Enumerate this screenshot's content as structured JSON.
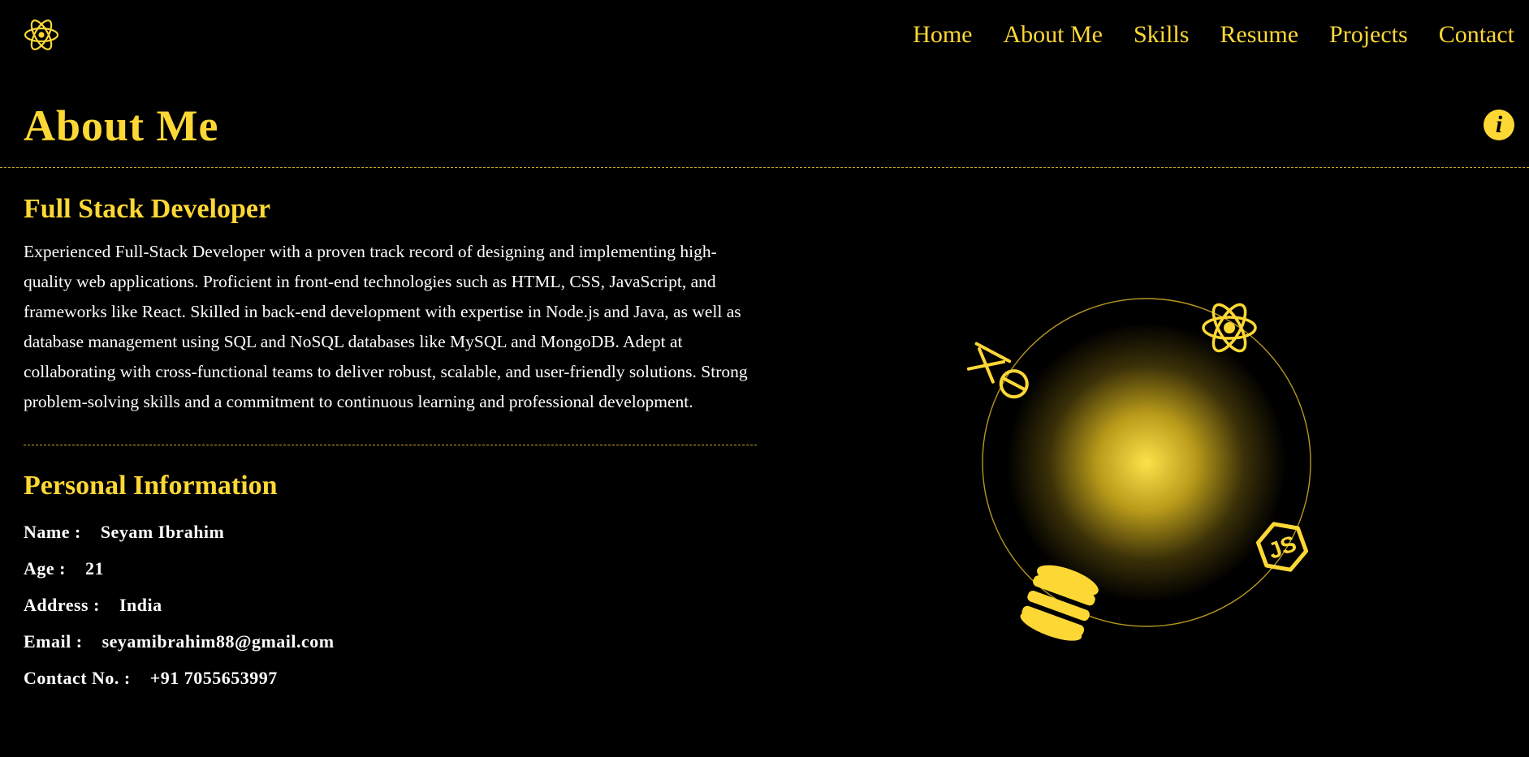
{
  "header": {
    "logo_icon": "react-atom-icon",
    "nav": [
      {
        "label": "Home"
      },
      {
        "label": "About Me"
      },
      {
        "label": "Skills"
      },
      {
        "label": "Resume"
      },
      {
        "label": "Projects"
      },
      {
        "label": "Contact"
      }
    ]
  },
  "page": {
    "title": "About Me",
    "info_icon": "info-icon"
  },
  "about": {
    "heading": "Full Stack Developer",
    "bio": "Experienced Full-Stack Developer with a proven track record of designing and implementing high-quality web applications. Proficient in front-end technologies such as HTML, CSS, JavaScript, and frameworks like React. Skilled in back-end development with expertise in Node.js and Java, as well as database management using SQL and NoSQL databases like MySQL and MongoDB. Adept at collaborating with cross-functional teams to deliver robust, scalable, and user-friendly solutions. Strong problem-solving skills and a commitment to continuous learning and professional development."
  },
  "personal": {
    "heading": "Personal Information",
    "fields": [
      {
        "label": "Name :",
        "value": "Seyam Ibrahim"
      },
      {
        "label": "Age :",
        "value": "21"
      },
      {
        "label": "Address :",
        "value": "India"
      },
      {
        "label": "Email :",
        "value": "seyamibrahim88@gmail.com"
      },
      {
        "label": "Contact No. :",
        "value": "+91 7055653997"
      }
    ]
  },
  "graphic": {
    "orbit_icons": [
      "express-icon",
      "react-atom-icon",
      "nodejs-icon",
      "database-icon"
    ]
  },
  "colors": {
    "accent": "#fdd835",
    "background": "#000000",
    "text": "#ffffff",
    "divider": "#c9a827"
  }
}
